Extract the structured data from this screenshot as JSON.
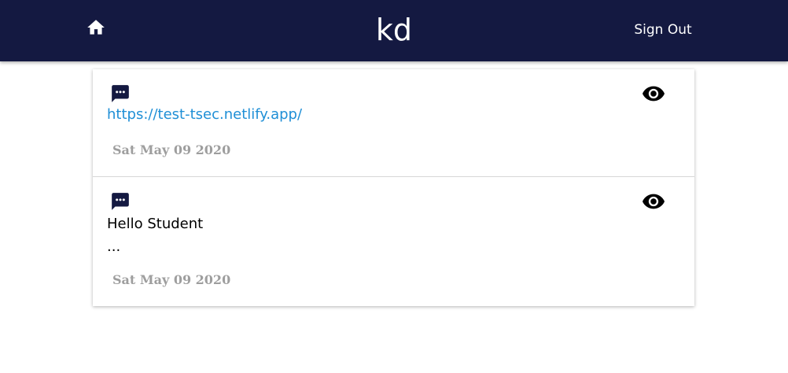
{
  "header": {
    "title": "kd",
    "sign_out_label": "Sign Out",
    "home_icon": "home-icon",
    "background_color": "#141941"
  },
  "messages": [
    {
      "icon": "chat-bubble-icon",
      "content": "https://test-tsec.netlify.app/",
      "is_link": true,
      "date": "Sat May 09 2020",
      "action_icon": "eye-icon"
    },
    {
      "icon": "chat-bubble-icon",
      "content": "Hello Student\n...",
      "is_link": false,
      "date": "Sat May 09 2020",
      "action_icon": "eye-icon"
    }
  ],
  "colors": {
    "link": "#1f8fd6",
    "date": "#9e9e9e",
    "icon": "#141941"
  }
}
